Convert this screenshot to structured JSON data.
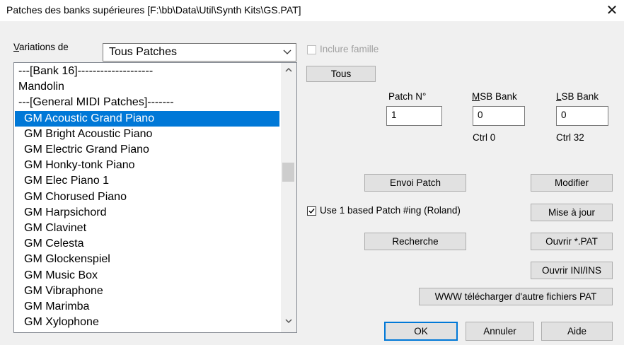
{
  "window": {
    "title": "Patches des banks supérieures [F:\\bb\\Data\\Util\\Synth Kits\\GS.PAT]"
  },
  "variations": {
    "label_underlined": "V",
    "label_rest": "ariations de",
    "selected": "Tous Patches"
  },
  "patches": [
    "---[Bank 16]--------------------",
    "Mandolin",
    "---[General MIDI Patches]-------",
    "GM Acoustic Grand Piano",
    "GM Bright Acoustic Piano",
    "GM Electric Grand Piano",
    "GM Honky-tonk Piano",
    "GM Elec Piano 1",
    "GM Chorused Piano",
    "GM Harpsichord",
    "GM Clavinet",
    "GM Celesta",
    "GM Glockenspiel",
    "GM Music Box",
    "GM Vibraphone",
    "GM Marimba",
    "GM Xylophone"
  ],
  "selected_index": 3,
  "include_family": {
    "label": "Inclure famille",
    "checked": false,
    "enabled": false
  },
  "buttons": {
    "tous": "Tous",
    "envoi_patch": "Envoi Patch",
    "modifier": "Modifier",
    "mise_a_jour": "Mise à jour",
    "recherche": "Recherche",
    "ouvrir_pat": "Ouvrir *.PAT",
    "ouvrir_ini": "Ouvrir INI/INS",
    "www": "WWW télécharger d'autre fichiers PAT",
    "ok": "OK",
    "annuler": "Annuler",
    "aide": "Aide"
  },
  "patch_no": {
    "label": "Patch N°",
    "value": "1"
  },
  "msb": {
    "label_underlined": "M",
    "label_rest": "SB Bank",
    "value": "0",
    "ctrl": "Ctrl 0"
  },
  "lsb": {
    "label_underlined": "L",
    "label_rest": "SB Bank",
    "value": "0",
    "ctrl": "Ctrl 32"
  },
  "use_one_based": {
    "label": "Use 1 based Patch #ing (Roland)",
    "checked": true
  }
}
